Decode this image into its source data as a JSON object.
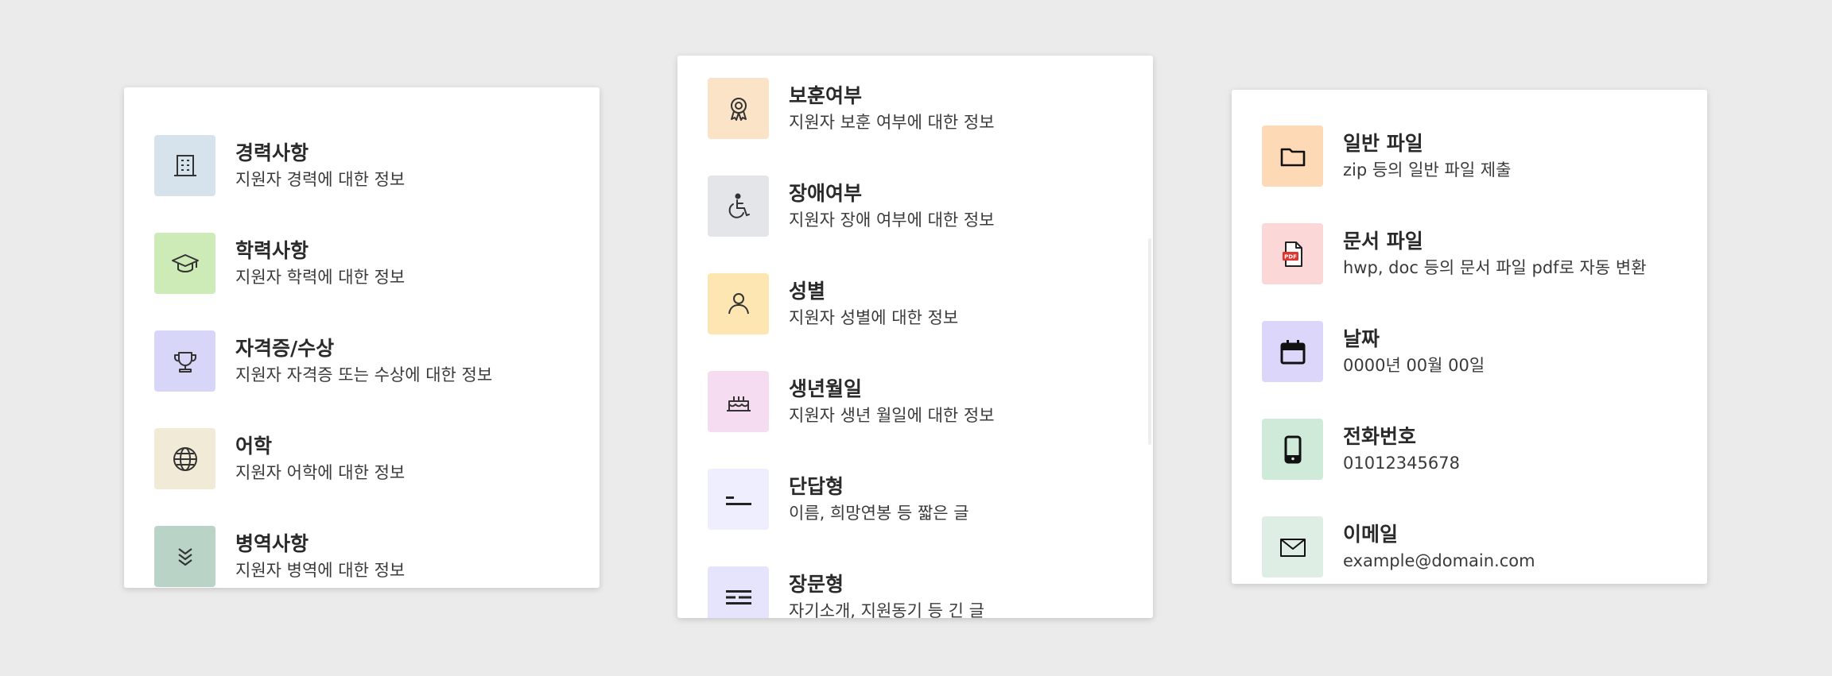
{
  "cards": [
    {
      "items": [
        {
          "title": "경력사항",
          "desc": "지원자 경력에 대한 정보",
          "icon": "building-icon",
          "bg": "#d6e2ec"
        },
        {
          "title": "학력사항",
          "desc": "지원자 학력에 대한 정보",
          "icon": "graduation-cap-icon",
          "bg": "#cdebb6"
        },
        {
          "title": "자격증/수상",
          "desc": "지원자 자격증 또는 수상에 대한 정보",
          "icon": "trophy-icon",
          "bg": "#d8d6f8"
        },
        {
          "title": "어학",
          "desc": "지원자 어학에 대한 정보",
          "icon": "globe-icon",
          "bg": "#f0ead7"
        },
        {
          "title": "병역사항",
          "desc": "지원자 병역에 대한 정보",
          "icon": "chevrons-down-icon",
          "bg": "#bad3c7"
        }
      ]
    },
    {
      "items": [
        {
          "title": "보훈여부",
          "desc": "지원자 보훈 여부에 대한 정보",
          "icon": "medal-icon",
          "bg": "#fbe3c8"
        },
        {
          "title": "장애여부",
          "desc": "지원자 장애 여부에 대한 정보",
          "icon": "wheelchair-icon",
          "bg": "#e4e5e9"
        },
        {
          "title": "성별",
          "desc": "지원자 성별에 대한 정보",
          "icon": "person-icon",
          "bg": "#fde6b2"
        },
        {
          "title": "생년월일",
          "desc": "지원자 생년 월일에 대한 정보",
          "icon": "cake-icon",
          "bg": "#f6dcf1"
        },
        {
          "title": "단답형",
          "desc": "이름, 희망연봉 등 짧은 글",
          "icon": "short-text-icon",
          "bg": "#efeefe"
        },
        {
          "title": "장문형",
          "desc": "자기소개, 지원동기 등 긴 글",
          "icon": "long-text-icon",
          "bg": "#e6e4fd"
        }
      ]
    },
    {
      "items": [
        {
          "title": "일반 파일",
          "desc": "zip 등의 일반 파일 제출",
          "icon": "folder-icon",
          "bg": "#fdd9b5"
        },
        {
          "title": "문서 파일",
          "desc": "hwp, doc 등의 문서 파일 pdf로 자동 변환",
          "icon": "pdf-file-icon",
          "bg": "#fbd7d8"
        },
        {
          "title": "날짜",
          "desc": "0000년 00월 00일",
          "icon": "calendar-icon",
          "bg": "#dcd6fb"
        },
        {
          "title": "전화번호",
          "desc": "01012345678",
          "icon": "phone-icon",
          "bg": "#cfead9"
        },
        {
          "title": "이메일",
          "desc": "example@domain.com",
          "icon": "mail-icon",
          "bg": "#dfeee4"
        }
      ]
    }
  ],
  "pdf_badge": "PDF"
}
